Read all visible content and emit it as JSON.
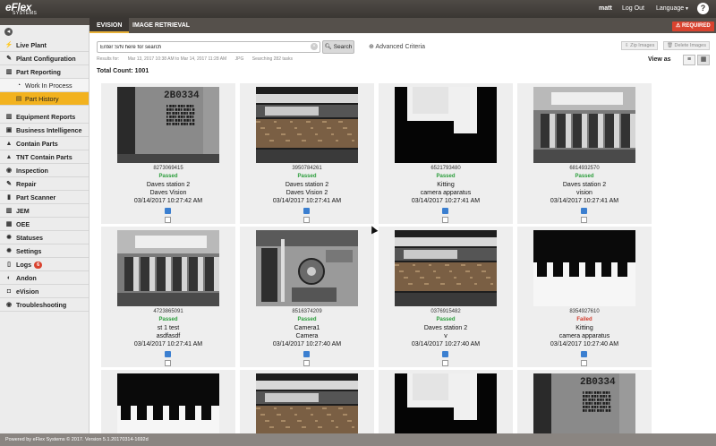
{
  "app": {
    "logo_main": "eFlex",
    "logo_sub": "SYSTEMS",
    "user": "matt",
    "logout": "Log Out",
    "language": "Language",
    "help": "?"
  },
  "tabs": [
    {
      "label": "EVISION"
    },
    {
      "label": "IMAGE RETRIEVAL"
    }
  ],
  "required_label": "REQUIRED",
  "sidebar": {
    "collapse_icon": "circle-arrow-icon",
    "items": [
      {
        "label": "Live Plant",
        "icon": "bolt-icon"
      },
      {
        "label": "Plant Configuration",
        "icon": "wrench-icon"
      },
      {
        "label": "Part Reporting",
        "icon": "chart-icon"
      },
      {
        "label": "Work In Process",
        "icon": "gauge-icon"
      },
      {
        "label": "Part History",
        "icon": "table-icon"
      },
      {
        "label": "Equipment Reports",
        "icon": "chart-icon"
      },
      {
        "label": "Business Intelligence",
        "icon": "briefcase-icon"
      },
      {
        "label": "Contain Parts",
        "icon": "warning-icon"
      },
      {
        "label": "TNT Contain Parts",
        "icon": "warning-icon"
      },
      {
        "label": "Inspection",
        "icon": "eye-icon"
      },
      {
        "label": "Repair",
        "icon": "wrench-icon"
      },
      {
        "label": "Part Scanner",
        "icon": "barcode-icon"
      },
      {
        "label": "JEM",
        "icon": "chart-icon"
      },
      {
        "label": "OEE",
        "icon": "grid-icon"
      },
      {
        "label": "Statuses",
        "icon": "gear-icon"
      },
      {
        "label": "Settings",
        "icon": "gear-icon"
      },
      {
        "label": "Logs",
        "icon": "document-icon",
        "badge": "6"
      },
      {
        "label": "Andon",
        "icon": "andon-icon"
      },
      {
        "label": "eVision",
        "icon": "camera-icon"
      },
      {
        "label": "Troubleshooting",
        "icon": "eye-icon"
      }
    ]
  },
  "search": {
    "placeholder": "Enter S/N here for search",
    "button": "Search",
    "advanced": "Advanced Criteria"
  },
  "toolbar": {
    "zip": "Zip Images",
    "delete": "Delete Images",
    "view_as": "View as"
  },
  "results": {
    "label": "Results for:",
    "range": "Mar 13, 2017 10:38 AM to Mar 14, 2017 11:28 AM",
    "type": "JPG",
    "searching": "Searching 282 tasks"
  },
  "total": "Total Count: 1001",
  "cards": [
    {
      "sn": "8273069415",
      "status": "Passed",
      "line1": "Daves station 2",
      "line2": "Daves Vision",
      "date": "03/14/2017 10:27:42 AM",
      "image": "barcode-part"
    },
    {
      "sn": "3950784261",
      "status": "Passed",
      "line1": "Daves station 2",
      "line2": "Daves Vision 2",
      "date": "03/14/2017 10:27:41 AM",
      "image": "rusty-part"
    },
    {
      "sn": "6521793480",
      "status": "Passed",
      "line1": "Kitting",
      "line2": "camera apparatus",
      "date": "03/14/2017 10:27:41 AM",
      "image": "dark-part"
    },
    {
      "sn": "6814932570",
      "status": "Passed",
      "line1": "Daves station 2",
      "line2": "vision",
      "date": "03/14/2017 10:27:41 AM",
      "image": "metal-part"
    },
    {
      "sn": "4723865091",
      "status": "Passed",
      "line1": "st 1 test",
      "line2": "asdfasdf",
      "date": "03/14/2017 10:27:41 AM",
      "image": "metal-part"
    },
    {
      "sn": "8516374209",
      "status": "Passed",
      "line1": "Camera1",
      "line2": "Camera",
      "date": "03/14/2017 10:27:40 AM",
      "image": "gears-part"
    },
    {
      "sn": "0376915482",
      "status": "Passed",
      "line1": "Daves station 2",
      "line2": "v",
      "date": "03/14/2017 10:27:40 AM",
      "image": "rusty-part"
    },
    {
      "sn": "8354927610",
      "status": "Failed",
      "line1": "Kitting",
      "line2": "camera apparatus",
      "date": "03/14/2017 10:27:40 AM",
      "image": "comb-part"
    },
    {
      "sn": "",
      "status": "",
      "line1": "",
      "line2": "",
      "date": "",
      "image": "comb-part"
    },
    {
      "sn": "",
      "status": "",
      "line1": "",
      "line2": "",
      "date": "",
      "image": "rusty-part"
    },
    {
      "sn": "",
      "status": "",
      "line1": "",
      "line2": "",
      "date": "",
      "image": "dark-part"
    },
    {
      "sn": "",
      "status": "",
      "line1": "",
      "line2": "",
      "date": "",
      "image": "barcode-part"
    }
  ],
  "barcode_text": "2B0334",
  "footer": "Powered by eFlex Systems © 2017.  Version 5.1.20170314-1692d"
}
